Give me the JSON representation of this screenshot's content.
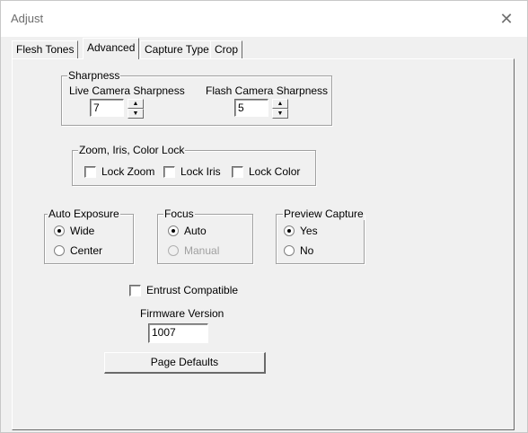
{
  "window": {
    "title": "Adjust",
    "close_glyph": "✕"
  },
  "tabs": [
    {
      "label": "Flesh Tones",
      "active": false
    },
    {
      "label": "Advanced",
      "active": true
    },
    {
      "label": "Capture Type",
      "active": false
    },
    {
      "label": "Crop",
      "active": false
    }
  ],
  "sharpness": {
    "title": "Sharpness",
    "live_label": "Live Camera Sharpness",
    "live_value": "7",
    "flash_label": "Flash Camera Sharpness",
    "flash_value": "5",
    "spin_up": "▲",
    "spin_down": "▼"
  },
  "lock": {
    "title": "Zoom, Iris, Color Lock",
    "zoom": "Lock Zoom",
    "iris": "Lock Iris",
    "color": "Lock Color"
  },
  "auto_exposure": {
    "title": "Auto Exposure",
    "options": [
      {
        "label": "Wide",
        "selected": true
      },
      {
        "label": "Center",
        "selected": false
      }
    ]
  },
  "focus": {
    "title": "Focus",
    "options": [
      {
        "label": "Auto",
        "selected": true
      },
      {
        "label": "Manual",
        "selected": false,
        "disabled": true
      }
    ]
  },
  "preview_capture": {
    "title": "Preview Capture",
    "options": [
      {
        "label": "Yes",
        "selected": true
      },
      {
        "label": "No",
        "selected": false
      }
    ]
  },
  "entrust": {
    "label": "Entrust Compatible"
  },
  "firmware": {
    "label": "Firmware Version",
    "value": "1007"
  },
  "page_defaults_label": "Page Defaults"
}
